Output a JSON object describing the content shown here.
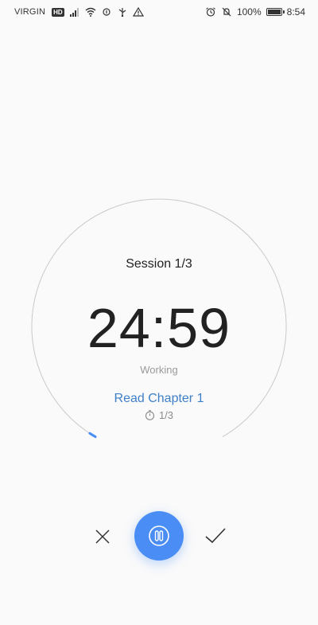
{
  "status_bar": {
    "carrier": "VIRGIN",
    "network_badge": "HD",
    "battery": "100%",
    "time": "8:54",
    "left_icons": [
      "signal-icon",
      "wifi-icon",
      "data-saver-icon",
      "usb-icon",
      "warning-icon"
    ],
    "right_icons": [
      "alarm-icon",
      "silent-icon",
      "battery-icon"
    ]
  },
  "timer": {
    "session": "Session 1/3",
    "time_remaining": "24:59",
    "state": "Working",
    "progress_fraction": 0.003,
    "ring_color": "#c9c9c9",
    "progress_color": "#4a8ef5"
  },
  "task": {
    "name": "Read Chapter 1",
    "progress": "1/3",
    "progress_icon": "stopwatch-icon",
    "color": "#3f7fc9"
  },
  "controls": {
    "cancel_icon": "close-icon",
    "pause_icon": "pause-icon",
    "done_icon": "checkmark-icon",
    "accent": "#4a8ef5"
  }
}
